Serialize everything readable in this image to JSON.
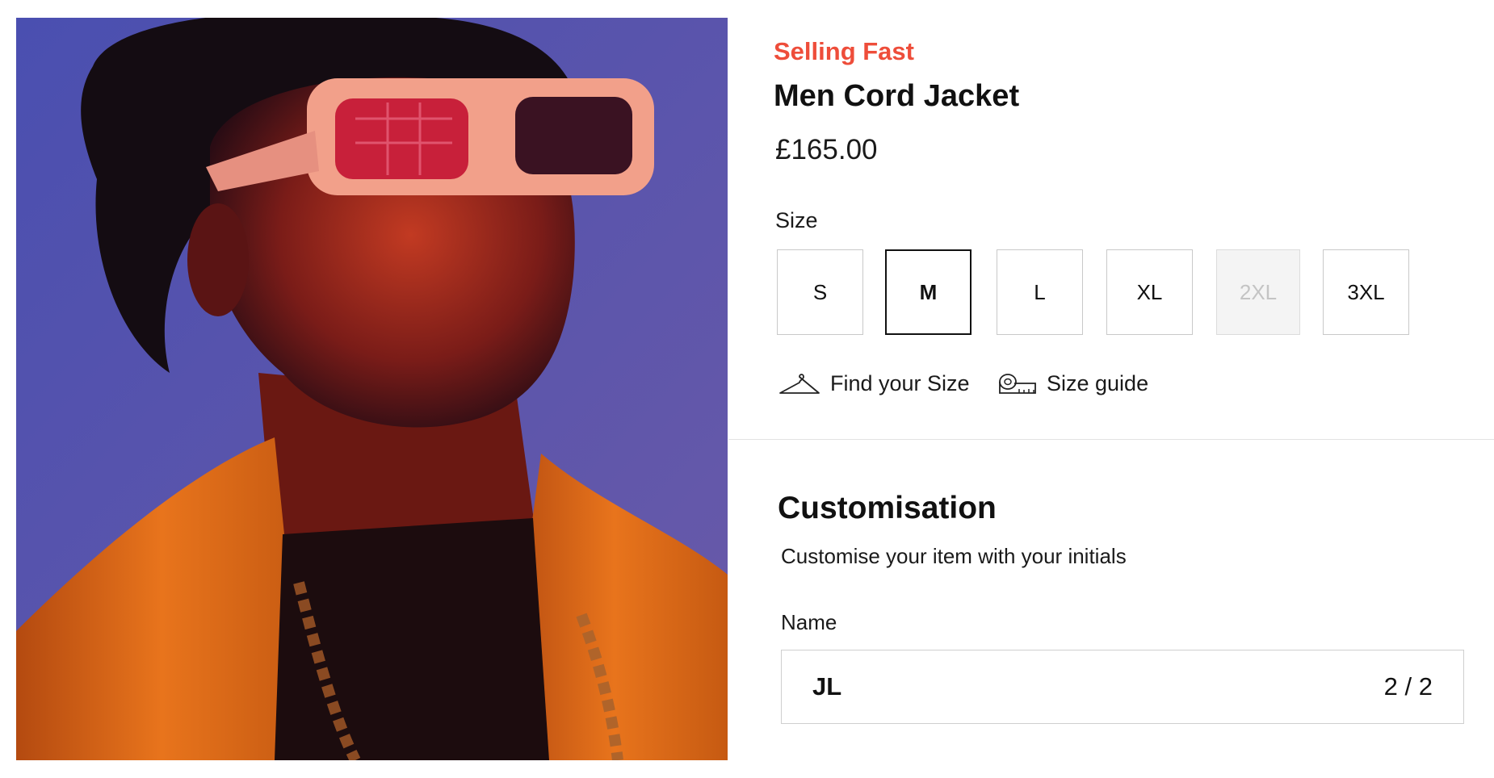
{
  "product": {
    "badge": "Selling Fast",
    "title": "Men Cord Jacket",
    "price": "£165.00",
    "image_alt": "Man wearing pink rectangular sunglasses and an orange cord jacket"
  },
  "size": {
    "label": "Size",
    "options": [
      {
        "label": "S",
        "state": "available"
      },
      {
        "label": "M",
        "state": "selected"
      },
      {
        "label": "L",
        "state": "available"
      },
      {
        "label": "XL",
        "state": "available"
      },
      {
        "label": "2XL",
        "state": "unavailable"
      },
      {
        "label": "3XL",
        "state": "available"
      }
    ],
    "find_size_label": "Find your Size",
    "size_guide_label": "Size guide"
  },
  "customisation": {
    "title": "Customisation",
    "subtitle": "Customise your item with your initials",
    "name_label": "Name",
    "name_value": "JL",
    "char_count": "2 / 2"
  },
  "colors": {
    "badge": "#ee4d3a",
    "text": "#111111",
    "border": "#c9c9c9",
    "disabled_bg": "#f4f4f4"
  },
  "icons": [
    "hanger-icon",
    "tape-measure-icon"
  ]
}
